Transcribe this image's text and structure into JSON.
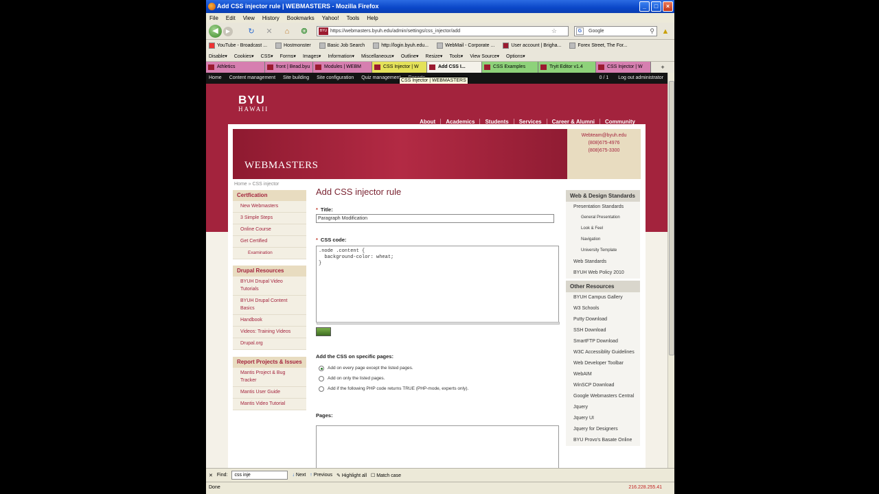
{
  "window": {
    "title": "Add CSS injector rule | WEBMASTERS - Mozilla Firefox"
  },
  "menu": [
    "File",
    "Edit",
    "View",
    "History",
    "Bookmarks",
    "Yahoo!",
    "Tools",
    "Help"
  ],
  "nav": {
    "url": "https://webmasters.byuh.edu/admin/settings/css_injector/add",
    "search_placeholder": "Google"
  },
  "bookmarks": [
    "YouTube - Broadcast ...",
    "Hostmonster",
    "Basic Job Search",
    "http://login.byuh.edu...",
    "WebMail - Corporate ...",
    "User account | Brigha...",
    "Forex Street, The For..."
  ],
  "webdev_toolbar": [
    "Disable▾",
    "Cookies▾",
    "CSS▾",
    "Forms▾",
    "Images▾",
    "Information▾",
    "Miscellaneous▾",
    "Outline▾",
    "Resize▾",
    "Tools▾",
    "View Source▾",
    "Options▾"
  ],
  "tabs": [
    {
      "label": "Athletics",
      "color": "#d67fb0"
    },
    {
      "label": "front | Bead.byu",
      "color": "#d67fb0"
    },
    {
      "label": "Modules | WEBM",
      "color": "#d67fb0"
    },
    {
      "label": "CSS Injector | W",
      "color": "#e4e25a"
    },
    {
      "label": "Add CSS I...",
      "color": "#f4f2ea",
      "active": true
    },
    {
      "label": "CSS Examples",
      "color": "#8ed27a"
    },
    {
      "label": "Tryit Editor v1.4",
      "color": "#8ed27a"
    },
    {
      "label": "CSS Injector | W",
      "color": "#d67fb0"
    }
  ],
  "adminbar": {
    "items": [
      "Home",
      "Content management",
      "Site building",
      "Site configuration",
      "Quiz management",
      "Reports"
    ],
    "count": "0 / 1",
    "logout": "Log out administrator",
    "tooltip": "CSS Injector | WEBMASTERS"
  },
  "site": {
    "logo_top": "BYU",
    "logo_bottom": "HAWAII",
    "topnav": [
      "About",
      "Academics",
      "Students",
      "Services",
      "Career & Alumni",
      "Community"
    ],
    "banner_title": "WEBMASTERS",
    "contact": [
      "Webteam@byuh.edu",
      "(808)675-4976",
      "(808)675-3300"
    ],
    "breadcrumb": "Home » CSS injector"
  },
  "left": {
    "cert": {
      "title": "Certfication",
      "items": [
        "New Webmasters",
        "3 Simple Steps",
        "Online Course",
        "Get Certified",
        "Examination"
      ]
    },
    "drupal": {
      "title": "Drupal Resources",
      "items": [
        "BYUH Drupal Video Tutorials",
        "BYUH Drupal Content Basics",
        "Handbook",
        "Videos: Training Videos",
        "Drupal.org"
      ]
    },
    "report": {
      "title": "Report Projects & Issues",
      "items": [
        "Mantis Project & Bug Tracker",
        "Mantis User Guide",
        "Mantis Video Tutorial"
      ]
    }
  },
  "main": {
    "heading": "Add CSS injector rule",
    "title_label": "Title:",
    "title_value": "Paragraph Modification",
    "css_label": "CSS code:",
    "css_value": ".node .content {\n  background-color: wheat;\n}",
    "pages_heading": "Add the CSS on specific pages:",
    "radio_1": "Add on every page except the listed pages.",
    "radio_2": "Add on only the listed pages.",
    "radio_3": "Add if the following PHP code returns TRUE (PHP-mode, experts only).",
    "pages_label": "Pages:"
  },
  "right": {
    "standards": {
      "title": "Web & Design Standards",
      "items": [
        "Presentation Standards",
        "General Presentation",
        "Look & Feel",
        "Navigation",
        "University Template",
        "Web Standards",
        "BYUH Web Policy 2010"
      ]
    },
    "other": {
      "title": "Other Resources",
      "items": [
        "BYUH Campus Gallery",
        "W3 Schools",
        "Putty Download",
        "SSH Download",
        "SmartFTP Download",
        "W3C Accessiblity Guidelines",
        "Web Developer Toolbar",
        "WebAIM",
        "WinSCP Download",
        "Google Webmasters Central",
        "Jquery",
        "Jquery UI",
        "Jquery for Designers",
        "BYU Provo's Basate Online"
      ]
    }
  },
  "findbar": {
    "label": "Find:",
    "value": "css inje",
    "next": "Next",
    "previous": "Previous",
    "highlight": "Highlight all",
    "matchcase": "Match case"
  },
  "status": {
    "text": "Done",
    "ip": "216.228.255.41"
  },
  "colors": {
    "byu_red": "#a3233d",
    "titlebar": "#0a46c8"
  }
}
